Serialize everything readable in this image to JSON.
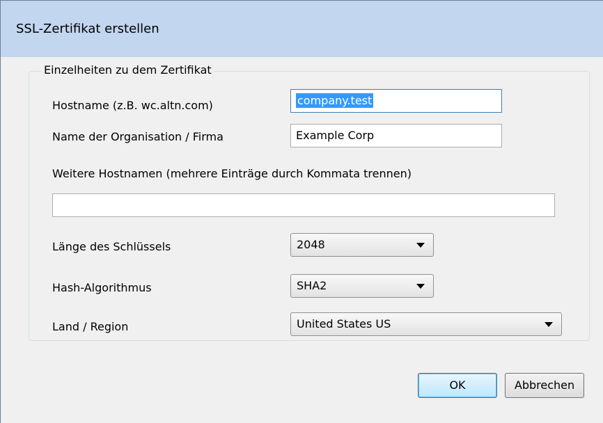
{
  "window": {
    "title": "SSL-Zertifikat erstellen"
  },
  "group": {
    "legend": "Einzelheiten zu dem Zertifikat"
  },
  "fields": {
    "hostname": {
      "label": "Hostname (z.B. wc.altn.com)",
      "value": "company.test"
    },
    "organisation": {
      "label": "Name der Organisation / Firma",
      "value": "Example Corp"
    },
    "alt_hostnames": {
      "label": "Weitere Hostnamen (mehrere Einträge durch Kommata trennen)",
      "value": ""
    },
    "key_length": {
      "label": "Länge des Schlüssels",
      "value": "2048"
    },
    "hash_algorithm": {
      "label": "Hash-Algorithmus",
      "value": "SHA2"
    },
    "country": {
      "label": "Land / Region",
      "value": "United States US"
    }
  },
  "buttons": {
    "ok": "OK",
    "cancel": "Abbrechen"
  },
  "icons": {
    "dropdown": "chevron-down-icon"
  }
}
